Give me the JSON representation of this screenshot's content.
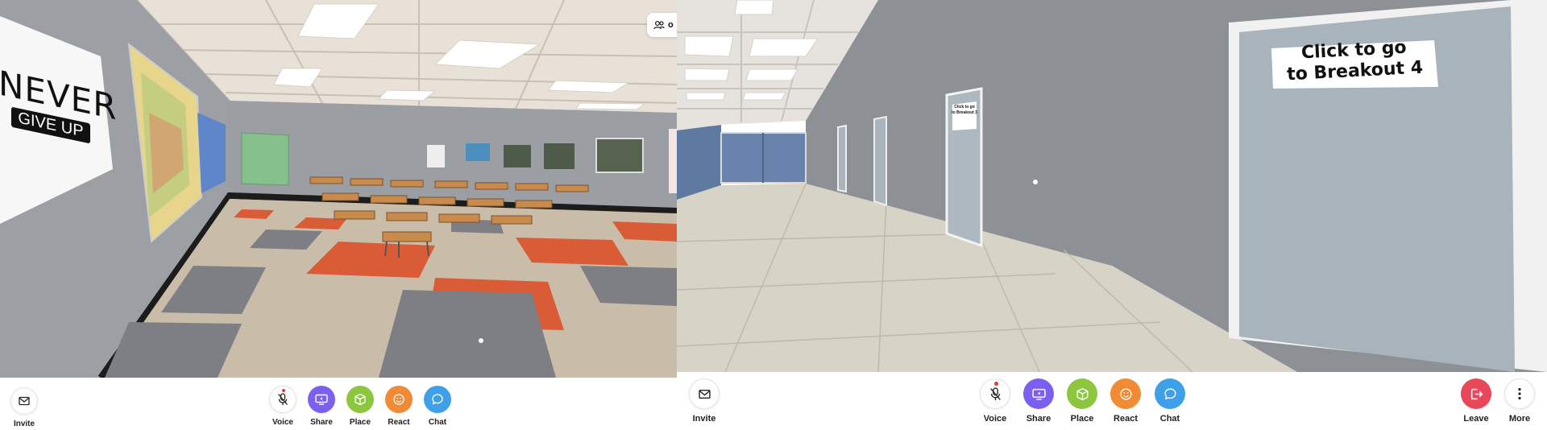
{
  "left_view": {
    "poster": {
      "line1": "NEVER",
      "line2": "GIVE UP"
    },
    "top_chip_text": "o",
    "toolbar": {
      "invite": "Invite",
      "voice": "Voice",
      "share": "Share",
      "place": "Place",
      "react": "React",
      "chat": "Chat"
    }
  },
  "right_view": {
    "door_sign": {
      "line1": "Click to go",
      "line2": "to Breakout 4"
    },
    "small_sign": {
      "line1": "Click to go",
      "line2": "to Breakout 3"
    },
    "toolbar": {
      "invite": "Invite",
      "voice": "Voice",
      "share": "Share",
      "place": "Place",
      "react": "React",
      "chat": "Chat",
      "leave": "Leave",
      "more": "More"
    }
  },
  "colors": {
    "share": "#7b5ff0",
    "place": "#8cc63f",
    "react": "#f08a34",
    "chat": "#3ea0e8",
    "leave": "#e8485a",
    "voice_dot": "#e53935"
  },
  "icons": [
    "mail-icon",
    "mic-off-icon",
    "screen-share-icon",
    "cube-icon",
    "smile-icon",
    "chat-bubble-icon",
    "leave-icon",
    "more-vertical-icon",
    "people-icon"
  ]
}
